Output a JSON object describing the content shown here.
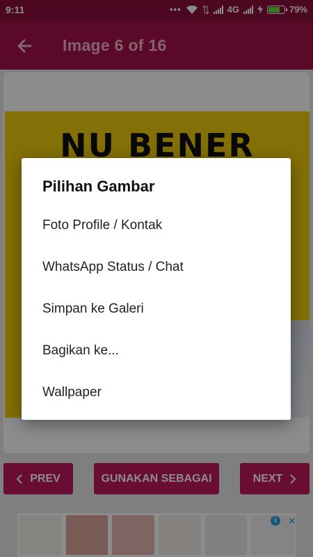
{
  "status_bar": {
    "time": "9:11",
    "network_type": "4G",
    "battery_percent": "79%",
    "battery_level": 0.79,
    "icons": [
      "more-dots-icon",
      "wifi-icon",
      "data-arrows-icon",
      "signal-icon",
      "signal-icon",
      "charging-icon",
      "battery-icon"
    ]
  },
  "app_bar": {
    "back_icon": "arrow-left-icon",
    "title": "Image 6 of 16"
  },
  "image": {
    "visible_text": "NU BENER",
    "background_color": "#efcc0c"
  },
  "buttons": {
    "prev_label": "PREV",
    "use_label": "GUNAKAN SEBAGAI",
    "next_label": "NEXT",
    "color": "#c2185b"
  },
  "dialog": {
    "title": "Pilihan Gambar",
    "options": [
      {
        "label": "Foto Profile / Kontak"
      },
      {
        "label": "WhatsApp Status / Chat"
      },
      {
        "label": "Simpan ke Galeri"
      },
      {
        "label": "Bagikan ke..."
      },
      {
        "label": "Wallpaper"
      }
    ]
  },
  "colors": {
    "status_bar": "#8a0f3c",
    "app_bar": "#a6124a",
    "accent": "#c2185b"
  }
}
